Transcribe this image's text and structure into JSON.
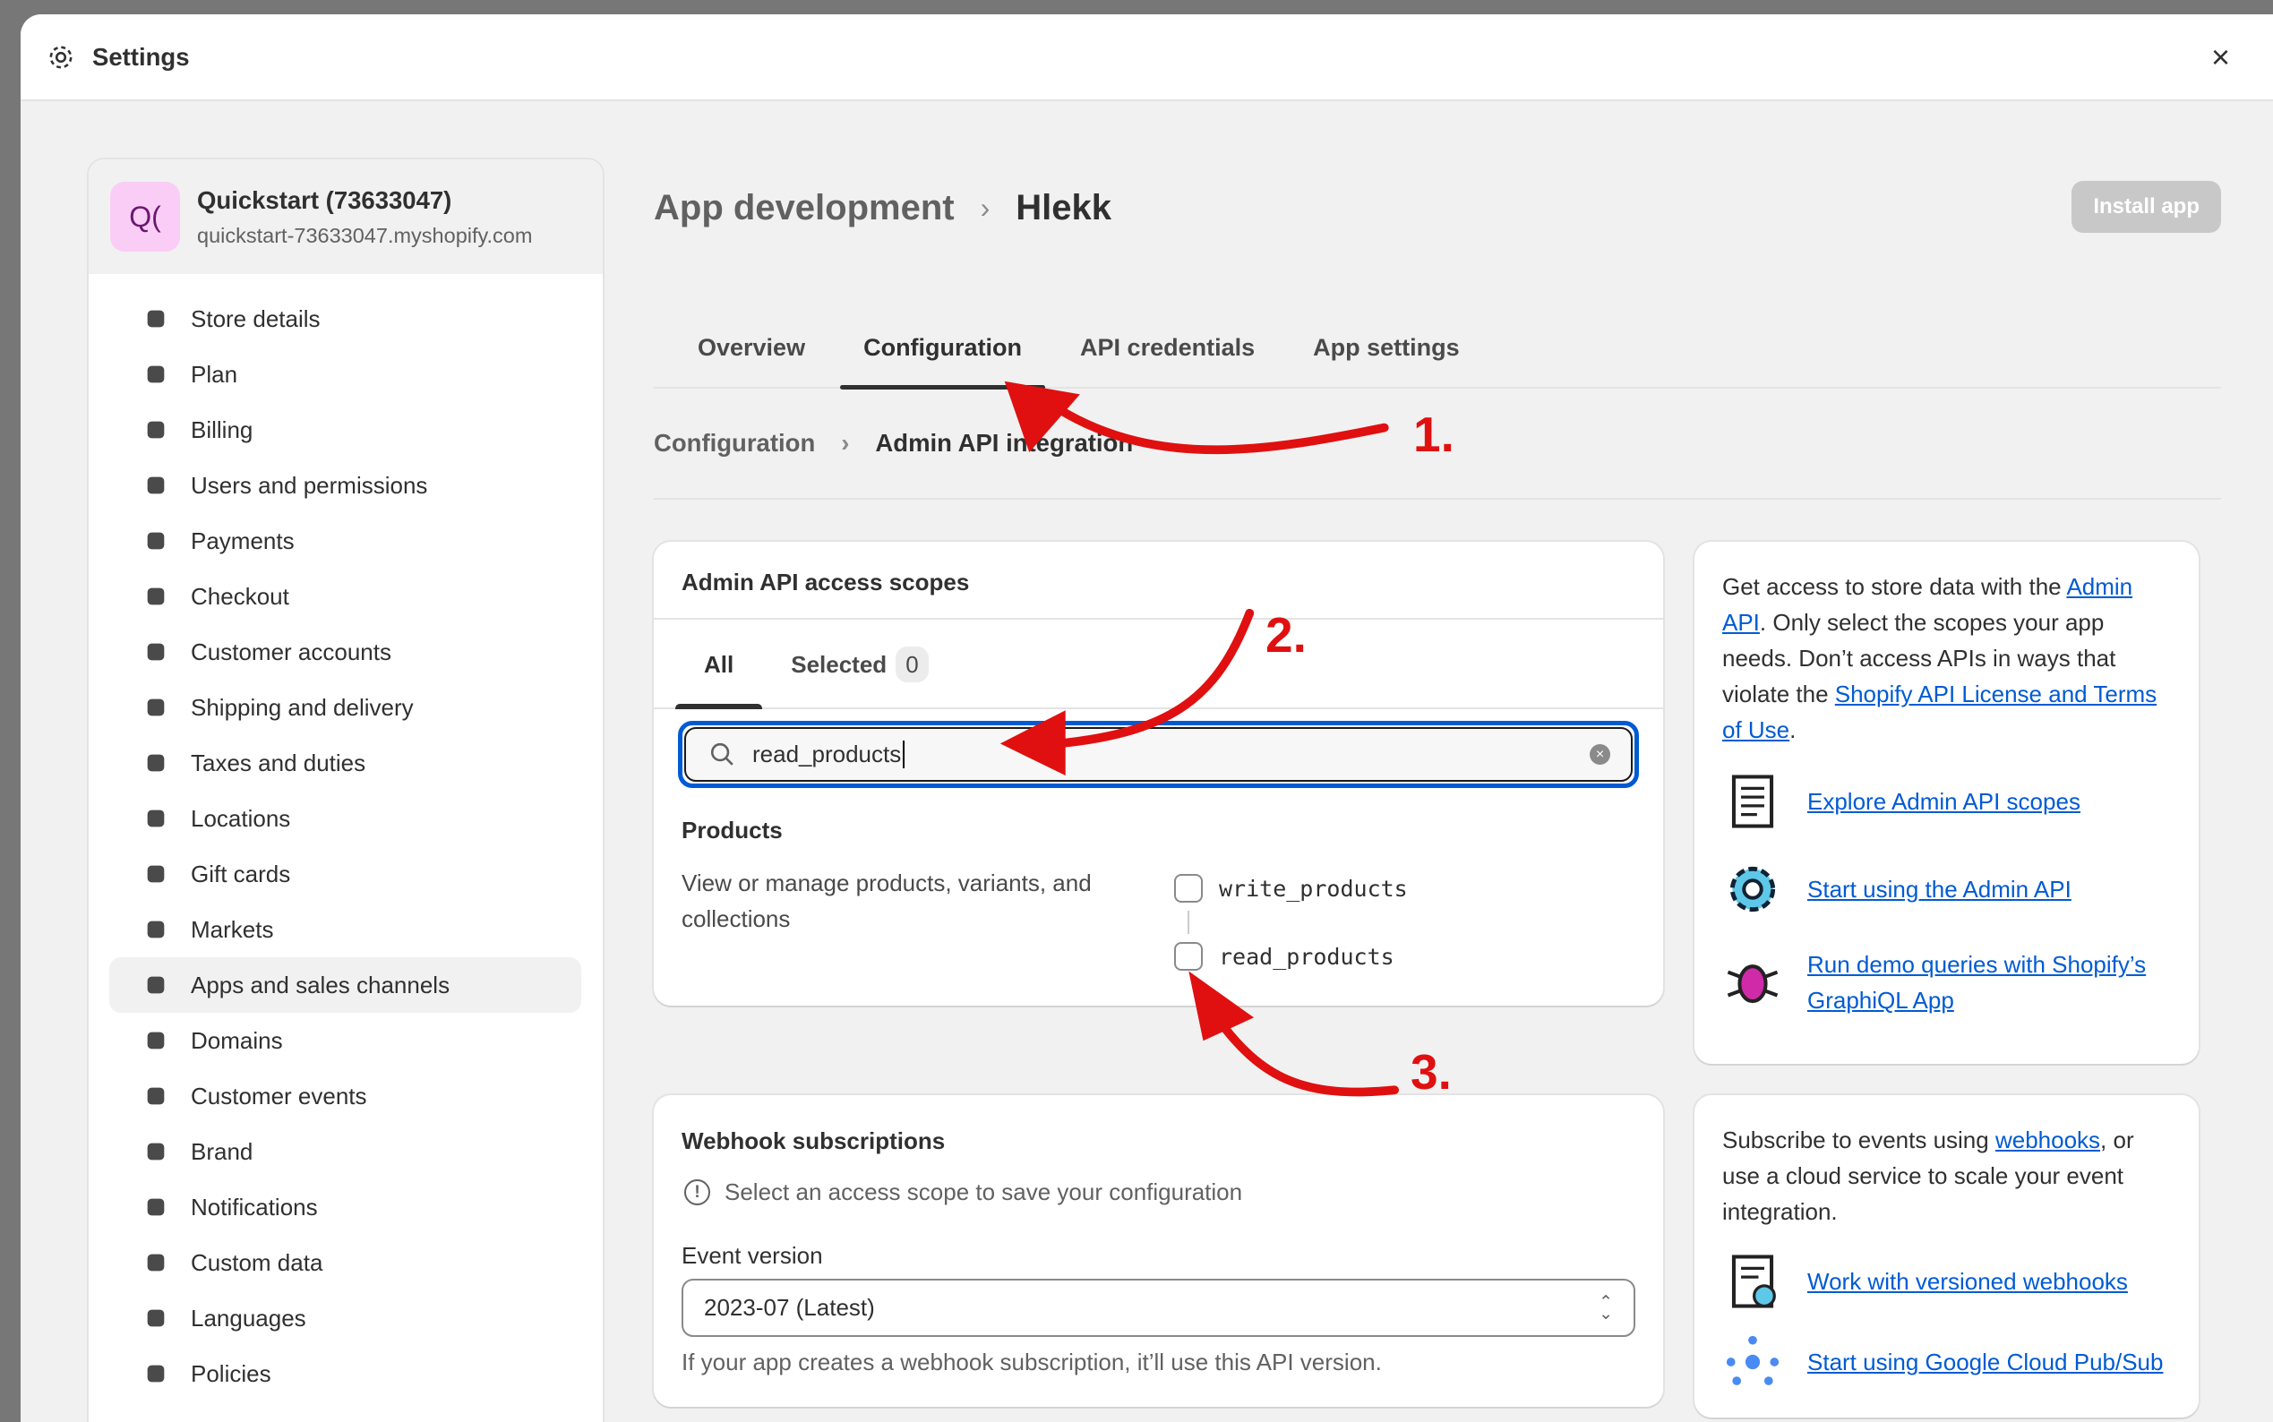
{
  "window": {
    "title": "Settings",
    "close_label": "×"
  },
  "store": {
    "avatar": "Q(",
    "name": "Quickstart (73633047)",
    "domain": "quickstart-73633047.myshopify.com"
  },
  "sidebar": {
    "items": [
      {
        "label": "Store details",
        "icon": "store-icon"
      },
      {
        "label": "Plan",
        "icon": "plan-icon"
      },
      {
        "label": "Billing",
        "icon": "billing-icon"
      },
      {
        "label": "Users and permissions",
        "icon": "users-icon"
      },
      {
        "label": "Payments",
        "icon": "payments-icon"
      },
      {
        "label": "Checkout",
        "icon": "cart-icon"
      },
      {
        "label": "Customer accounts",
        "icon": "person-icon"
      },
      {
        "label": "Shipping and delivery",
        "icon": "truck-icon"
      },
      {
        "label": "Taxes and duties",
        "icon": "tax-icon"
      },
      {
        "label": "Locations",
        "icon": "location-icon"
      },
      {
        "label": "Gift cards",
        "icon": "gift-card-icon"
      },
      {
        "label": "Markets",
        "icon": "globe-icon"
      },
      {
        "label": "Apps and sales channels",
        "icon": "apps-icon",
        "active": true
      },
      {
        "label": "Domains",
        "icon": "domain-icon"
      },
      {
        "label": "Customer events",
        "icon": "events-icon"
      },
      {
        "label": "Brand",
        "icon": "brand-icon"
      },
      {
        "label": "Notifications",
        "icon": "bell-icon"
      },
      {
        "label": "Custom data",
        "icon": "custom-data-icon"
      },
      {
        "label": "Languages",
        "icon": "language-icon"
      },
      {
        "label": "Policies",
        "icon": "policy-icon"
      }
    ]
  },
  "header": {
    "parent": "App development",
    "separator": "›",
    "current": "Hlekk",
    "install_label": "Install app"
  },
  "tabs": [
    {
      "label": "Overview"
    },
    {
      "label": "Configuration",
      "active": true
    },
    {
      "label": "API credentials"
    },
    {
      "label": "App settings"
    }
  ],
  "breadcrumb": {
    "parent": "Configuration",
    "current": "Admin API integration"
  },
  "scopes": {
    "title": "Admin API access scopes",
    "tab_all": "All",
    "tab_selected": "Selected",
    "selected_count": "0",
    "search_value": "read_products",
    "group": "Products",
    "group_desc": "View or manage products, variants, and collections",
    "options": [
      {
        "label": "write_products",
        "checked": false
      },
      {
        "label": "read_products",
        "checked": false
      }
    ]
  },
  "webhooks": {
    "title": "Webhook subscriptions",
    "warning": "Select an access scope to save your configuration",
    "event_version_label": "Event version",
    "event_version_value": "2023-07 (Latest)",
    "hint": "If your app creates a webhook subscription, it’ll use this API version."
  },
  "info1": {
    "t1": "Get access to store data with the ",
    "link1": "Admin API",
    "t2": ". Only select the scopes your app needs. Don’t access APIs in ways that violate the ",
    "link2": "Shopify API License and Terms of Use",
    "t3": ".",
    "resources": [
      {
        "label": "Explore Admin API scopes",
        "icon": "document-icon"
      },
      {
        "label": "Start using the Admin API",
        "icon": "gear-icon"
      },
      {
        "label": "Run demo queries with Shopify’s GraphiQL App",
        "icon": "bug-icon"
      }
    ]
  },
  "info2": {
    "t1": "Subscribe to events using ",
    "link1": "webhooks",
    "t2": ", or use a cloud service to scale your event integration.",
    "resources": [
      {
        "label": "Work with versioned webhooks",
        "icon": "document-clock-icon"
      },
      {
        "label": "Start using Google Cloud Pub/Sub",
        "icon": "network-icon"
      }
    ]
  },
  "annotations": {
    "step1": "1.",
    "step2": "2.",
    "step3": "3.",
    "color": "#e01010"
  }
}
